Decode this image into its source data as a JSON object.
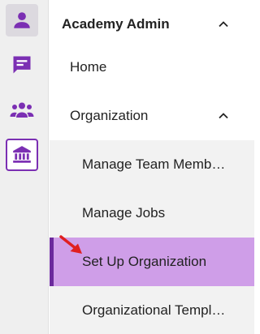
{
  "rail": {
    "items": [
      {
        "icon": "person-icon",
        "state": "active"
      },
      {
        "icon": "chat-icon",
        "state": "normal"
      },
      {
        "icon": "people-group-icon",
        "state": "normal"
      },
      {
        "icon": "bank-building-icon",
        "state": "focused"
      }
    ],
    "accent_color": "#7b2fb3"
  },
  "nav": {
    "section_title": "Academy Admin",
    "items": [
      {
        "label": "Home"
      },
      {
        "label": "Organization"
      }
    ],
    "organization_children": [
      {
        "label": "Manage Team Memb…"
      },
      {
        "label": "Manage Jobs"
      },
      {
        "label": "Set Up Organization",
        "selected": true
      },
      {
        "label": "Organizational Templ…"
      }
    ],
    "selected_bg": "#cf9ee8",
    "selected_bar_color": "#6b2a9c"
  },
  "annotation": {
    "icon": "red-arrow-icon",
    "color": "#e02020"
  }
}
